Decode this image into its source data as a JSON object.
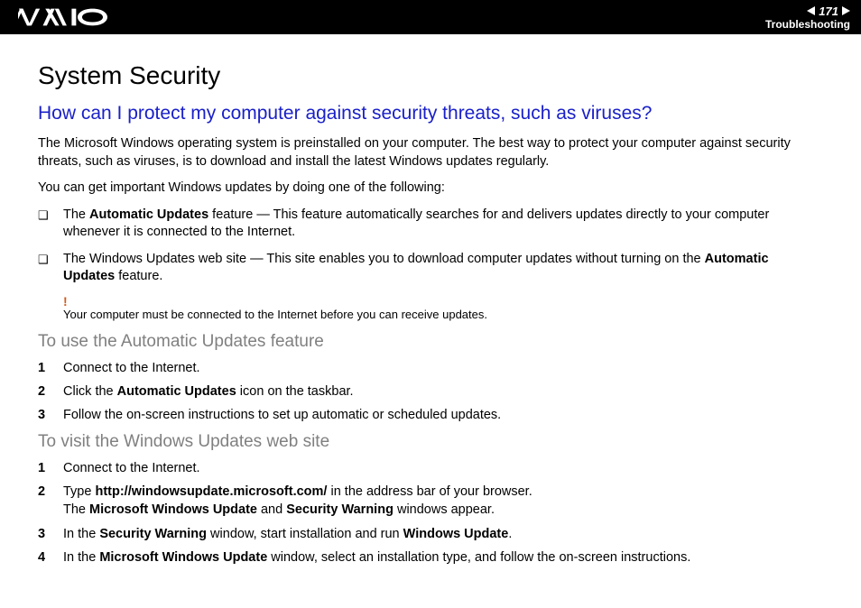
{
  "header": {
    "page_number": "171",
    "section": "Troubleshooting"
  },
  "title": "System Security",
  "question": "How can I protect my computer against security threats, such as viruses?",
  "intro1": "The Microsoft Windows operating system is preinstalled on your computer. The best way to protect your computer against security threats, such as viruses, is to download and install the latest Windows updates regularly.",
  "intro2": "You can get important Windows updates by doing one of the following:",
  "bullets": [
    {
      "pre": "The ",
      "bold1": "Automatic Updates",
      "post": " feature — This feature automatically searches for and delivers updates directly to your computer whenever it is connected to the Internet."
    },
    {
      "pre": "The Windows Updates web site — This site enables you to download computer updates without turning on the ",
      "bold1": "Automatic Updates",
      "post": " feature."
    }
  ],
  "note": {
    "bang": "!",
    "text": "Your computer must be connected to the Internet before you can receive updates."
  },
  "sub1": {
    "heading": "To use the Automatic Updates feature",
    "steps": [
      {
        "n": "1",
        "segments": [
          {
            "t": "Connect to the Internet."
          }
        ]
      },
      {
        "n": "2",
        "segments": [
          {
            "t": "Click the "
          },
          {
            "b": "Automatic Updates"
          },
          {
            "t": " icon on the taskbar."
          }
        ]
      },
      {
        "n": "3",
        "segments": [
          {
            "t": "Follow the on-screen instructions to set up automatic or scheduled updates."
          }
        ]
      }
    ]
  },
  "sub2": {
    "heading": "To visit the Windows Updates web site",
    "steps": [
      {
        "n": "1",
        "segments": [
          {
            "t": "Connect to the Internet."
          }
        ]
      },
      {
        "n": "2",
        "segments": [
          {
            "t": "Type "
          },
          {
            "b": "http://windowsupdate.microsoft.com/"
          },
          {
            "t": " in the address bar of your browser."
          },
          {
            "br": true
          },
          {
            "t": "The "
          },
          {
            "b": "Microsoft Windows Update"
          },
          {
            "t": " and "
          },
          {
            "b": "Security Warning"
          },
          {
            "t": " windows appear."
          }
        ]
      },
      {
        "n": "3",
        "segments": [
          {
            "t": "In the "
          },
          {
            "b": "Security Warning"
          },
          {
            "t": " window, start installation and run "
          },
          {
            "b": "Windows Update"
          },
          {
            "t": "."
          }
        ]
      },
      {
        "n": "4",
        "segments": [
          {
            "t": "In the "
          },
          {
            "b": "Microsoft Windows Update"
          },
          {
            "t": " window, select an installation type, and follow the on-screen instructions."
          }
        ]
      }
    ]
  }
}
